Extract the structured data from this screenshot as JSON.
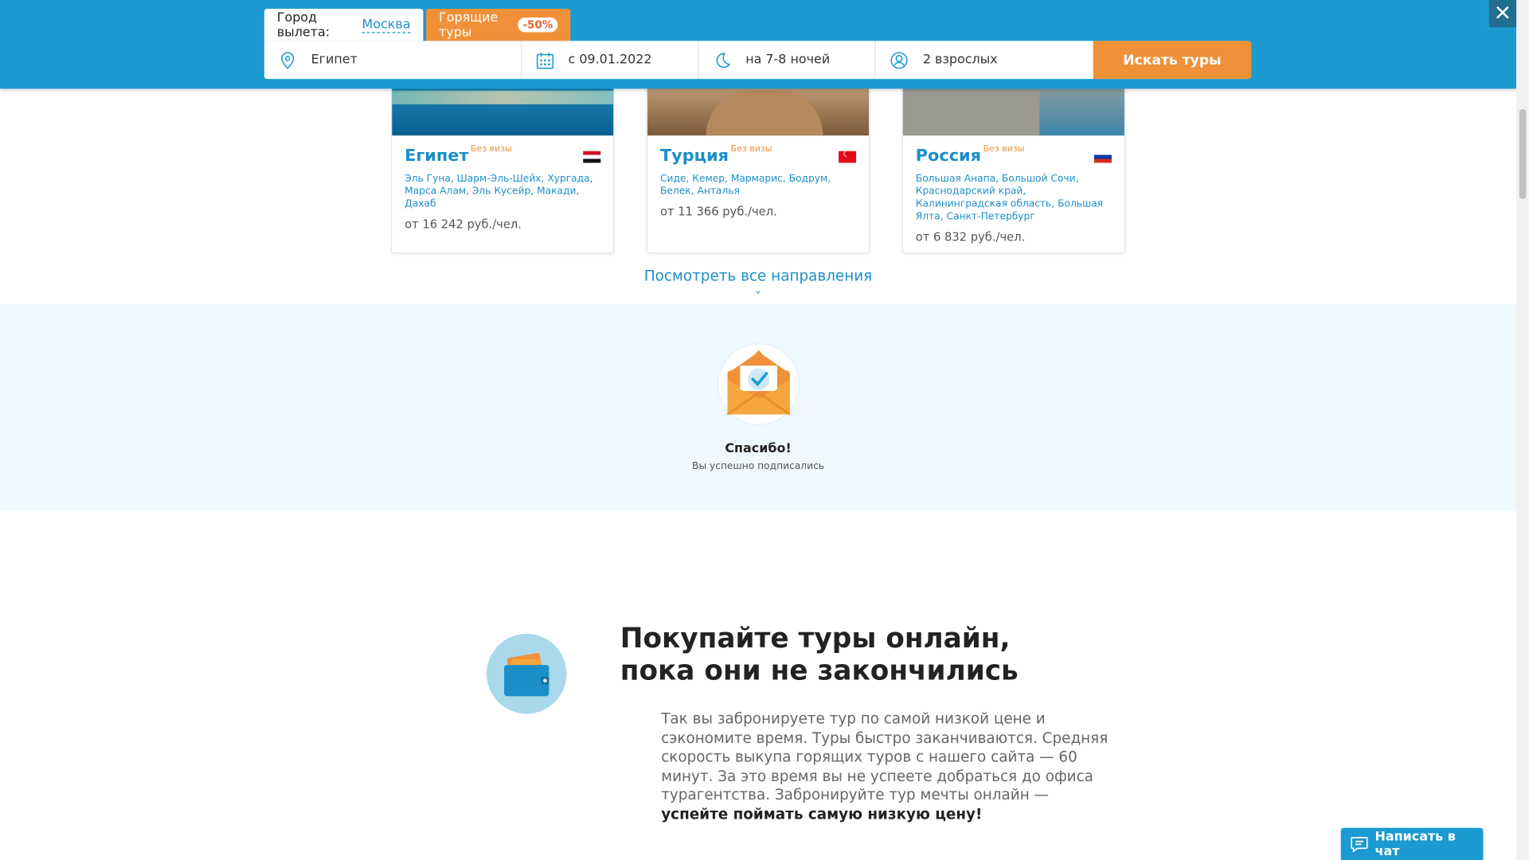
{
  "search_bar": {
    "departure_label": "Город вылета:",
    "departure_city": "Москва",
    "hot_tours_label": "Горящие туры",
    "hot_tours_badge": "-50%",
    "destination_value": "Египет",
    "date_value": "с 09.01.2022",
    "nights_value": "на 7-8 ночей",
    "travelers_value": "2 взрослых",
    "search_button": "Искать туры"
  },
  "close_button": "✕",
  "destinations": [
    {
      "name": "Египет",
      "visa_note": "Без визы",
      "flag_icon": "egypt-flag-icon",
      "cities": "Эль Гуна, Шарм-Эль-Шейх, Хургада, Марса Алам, Эль Кусейр, Макади, Дахаб",
      "price": "от 16 242 руб./чел."
    },
    {
      "name": "Турция",
      "visa_note": "Без визы",
      "flag_icon": "turkey-flag-icon",
      "cities": "Сиде, Кемер, Мармарис, Бодрум, Белек, Анталья",
      "price": "от 11 366 руб./чел."
    },
    {
      "name": "Россия",
      "visa_note": "Без визы",
      "flag_icon": "russia-flag-icon",
      "cities": "Большая Анапа, Большой Сочи, Краснодарский край, Калининградская область, Большая Ялта, Санкт-Петербург",
      "price": "от 6 832 руб./чел."
    }
  ],
  "all_destinations_link": "Посмотреть все направления",
  "subscribe": {
    "title": "Спасибо!",
    "subtitle": "Вы успешно подписались"
  },
  "buy_online": {
    "title_line1": "Покупайте туры онлайн,",
    "title_line2": "пока они не закончились",
    "text": "Так вы забронируете тур по самой низкой цене и сэкономите время. Туры быстро заканчиваются. Средняя скорость выкупа горящих туров с нашего сайта — 60 минут. За это время вы не успеете добраться до офиса турагентства. Забронируйте тур мечты онлайн — ",
    "text_bold": "успейте поймать самую низкую цену!"
  },
  "chat_button": "Написать в чат",
  "colors": {
    "primary_blue": "#1b9bd1",
    "accent_orange": "#f0913a",
    "link_blue": "#1b8fc8",
    "subscribe_bg": "#eff8fc"
  }
}
